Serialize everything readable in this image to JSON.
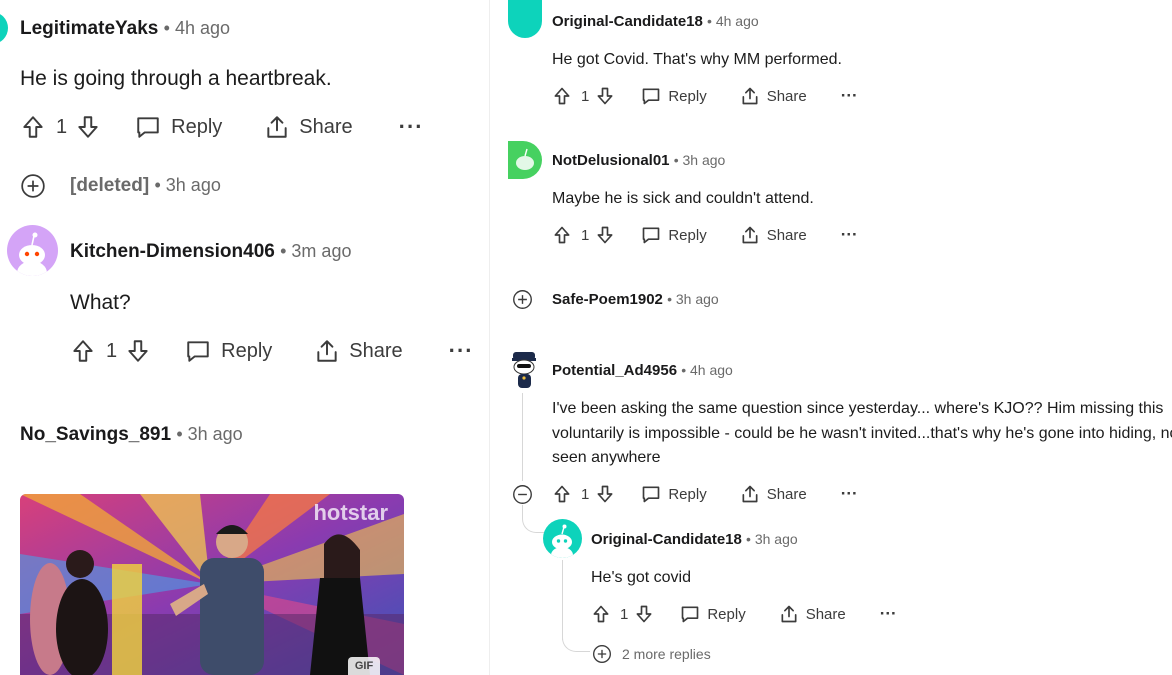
{
  "left": {
    "c1": {
      "author": "LegitimateYaks",
      "time": "4h ago",
      "body": "He is going through a heartbreak.",
      "votes": "1",
      "reply": "Reply",
      "share": "Share"
    },
    "c2": {
      "author": "[deleted]",
      "time": "3h ago"
    },
    "c3": {
      "author": "Kitchen-Dimension406",
      "time": "3m ago",
      "body": "What?",
      "votes": "1",
      "reply": "Reply",
      "share": "Share"
    },
    "c4": {
      "author": "No_Savings_891",
      "time": "3h ago",
      "gif_watermark": "hotstar",
      "gif_badge": "GIF"
    }
  },
  "right": {
    "c1": {
      "author": "Original-Candidate18",
      "time": "4h ago",
      "body": "He got Covid. That's why MM performed.",
      "votes": "1",
      "reply": "Reply",
      "share": "Share"
    },
    "c2": {
      "author": "NotDelusional01",
      "time": "3h ago",
      "body": "Maybe he is sick and couldn't attend.",
      "votes": "1",
      "reply": "Reply",
      "share": "Share"
    },
    "c3": {
      "author": "Safe-Poem1902",
      "time": "3h ago"
    },
    "c4": {
      "author": "Potential_Ad4956",
      "time": "4h ago",
      "body_lines": [
        "I've been asking the same question since yesterday... where's KJO?? Him missing this",
        "voluntarily is impossible - could be he wasn't invited...that's why he's gone into hiding, not",
        "seen anywhere"
      ],
      "votes": "1",
      "reply": "Reply",
      "share": "Share"
    },
    "c5": {
      "author": "Original-Candidate18",
      "time": "3h ago",
      "body": "He's got covid",
      "votes": "1",
      "reply": "Reply",
      "share": "Share"
    },
    "more_replies": "2 more replies"
  },
  "colors": {
    "accent_teal": "#0dd3bb",
    "snoo_green": "#46d160",
    "snoo_purple": "#d4a4f7",
    "meta_gray": "#6a6a6a"
  }
}
